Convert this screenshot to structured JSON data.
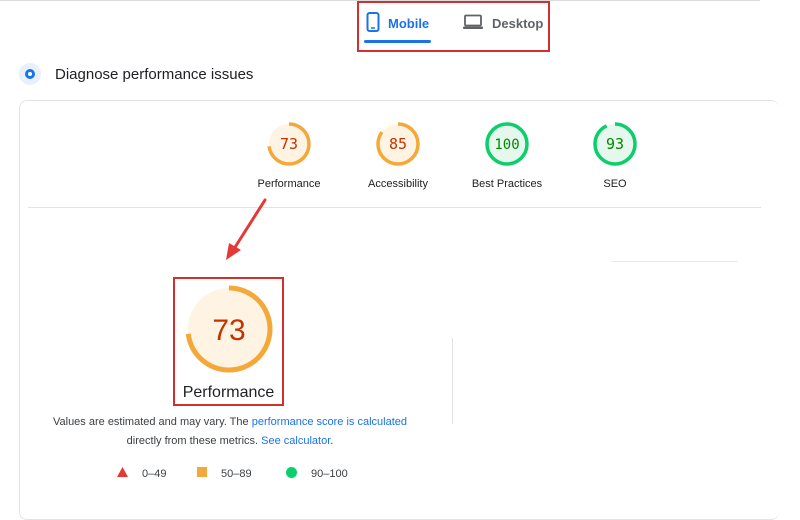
{
  "tabs": {
    "mobile_label": "Mobile",
    "desktop_label": "Desktop",
    "active": "mobile"
  },
  "section": {
    "title": "Diagnose performance issues"
  },
  "scores": [
    {
      "label": "Performance",
      "value": "73",
      "fraction": 0.73,
      "status": "average"
    },
    {
      "label": "Accessibility",
      "value": "85",
      "fraction": 0.85,
      "status": "average"
    },
    {
      "label": "Best Practices",
      "value": "100",
      "fraction": 1.0,
      "status": "pass"
    },
    {
      "label": "SEO",
      "value": "93",
      "fraction": 0.93,
      "status": "pass"
    }
  ],
  "main_score": {
    "label": "Performance",
    "value": "73",
    "fraction": 0.73
  },
  "explanation": {
    "text_1": "Values are estimated and may vary. The ",
    "link_1": "performance score is calculated",
    "text_2": "directly from these metrics. ",
    "link_2": "See calculator",
    "text_3": "."
  },
  "legend": {
    "fail": "0–49",
    "average": "50–89",
    "pass": "90–100"
  },
  "colors": {
    "accent": "#1a73e8",
    "highlight_box": "#d32f2f",
    "average_arc": "#f4a83a",
    "average_text": "#c33300",
    "average_fill": "#fff3e3",
    "pass_arc": "#0cce6b",
    "pass_text": "#008800",
    "pass_fill": "#e6f8ee",
    "fail": "#e53935"
  }
}
